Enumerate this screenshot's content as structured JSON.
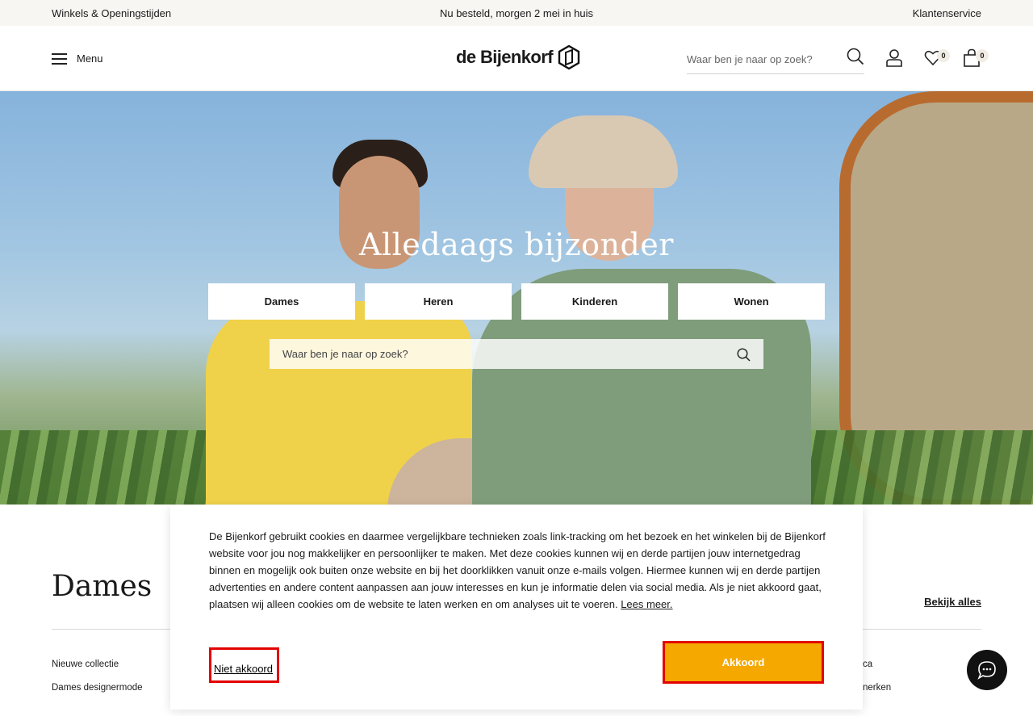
{
  "topbar": {
    "stores": "Winkels & Openingstijden",
    "delivery": "Nu besteld, morgen 2 mei in huis",
    "service": "Klantenservice"
  },
  "header": {
    "menu_label": "Menu",
    "logo_text": "de Bijenkorf",
    "search_placeholder": "Waar ben je naar op zoek?",
    "wishlist_count": "0",
    "cart_count": "0"
  },
  "hero": {
    "title": "Alledaags bijzonder",
    "categories": [
      "Dames",
      "Heren",
      "Kinderen",
      "Wonen"
    ],
    "search_placeholder": "Waar ben je naar op zoek?"
  },
  "section": {
    "title": "Dames",
    "view_all": "Bekijk alles",
    "links": [
      "Nieuwe collectie",
      "Dames designermode"
    ],
    "right_links_partial": [
      "ca",
      "nerken"
    ]
  },
  "cookie": {
    "text": "De Bijenkorf gebruikt cookies en daarmee vergelijkbare technieken zoals link-tracking om het bezoek en het winkelen bij de Bijenkorf website voor jou nog makkelijker en persoonlijker te maken. Met deze cookies kunnen wij en derde partijen jouw internetgedrag binnen en mogelijk ook buiten onze website en bij het doorklikken vanuit onze e-mails volgen. Hiermee kunnen wij en derde partijen advertenties en andere content aanpassen aan jouw interesses en kun je informatie delen via social media. Als je niet akkoord gaat, plaatsen wij alleen cookies om de website te laten werken en om analyses uit te voeren.",
    "read_more": "Lees meer.",
    "decline": "Niet akkoord",
    "accept": "Akkoord"
  },
  "colors": {
    "accent": "#f5a800",
    "highlight": "#e30000",
    "topbar_bg": "#f8f6f2"
  },
  "icons": [
    "hamburger-icon",
    "logo-hexagon-icon",
    "search-icon",
    "user-icon",
    "heart-icon",
    "bag-icon",
    "chat-icon"
  ]
}
